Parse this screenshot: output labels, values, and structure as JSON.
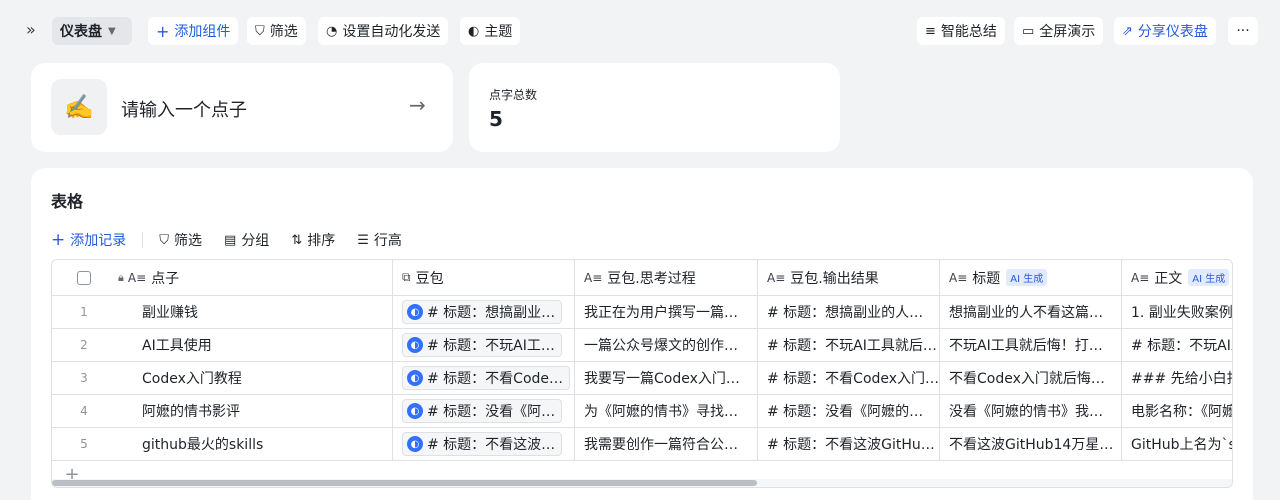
{
  "toolbar": {
    "dashboard_label": "仪表盘",
    "add_widget": "添加组件",
    "filter": "筛选",
    "automation": "设置自动化发送",
    "theme": "主题",
    "smart_summary": "智能总结",
    "fullscreen": "全屏演示",
    "share": "分享仪表盘",
    "more": "···"
  },
  "input_card": {
    "placeholder": "请输入一个点子",
    "icon": "✍️"
  },
  "count_card": {
    "label": "点字总数",
    "value": "5"
  },
  "table": {
    "title": "表格",
    "toolbar": {
      "add_record": "添加记录",
      "filter": "筛选",
      "group": "分组",
      "sort": "排序",
      "row_height": "行高"
    },
    "columns": [
      {
        "label": "点子",
        "ai": ""
      },
      {
        "label": "豆包",
        "ai": ""
      },
      {
        "label": "豆包.思考过程",
        "ai": ""
      },
      {
        "label": "豆包.输出结果",
        "ai": ""
      },
      {
        "label": "标题",
        "ai": "AI 生成"
      },
      {
        "label": "正文",
        "ai": "AI 生成"
      }
    ],
    "rows": [
      {
        "n": "1",
        "idea": "副业赚钱",
        "doubao": "# 标题：想搞副业…",
        "thinking": "我正在为用户撰写一篇…",
        "output": "# 标题：想搞副业的人…",
        "title": "想搞副业的人不看这篇…",
        "body": "1. 副业失败案例:"
      },
      {
        "n": "2",
        "idea": "AI工具使用",
        "doubao": "# 标题：不玩AI工…",
        "thinking": "一篇公众号爆文的创作…",
        "output": "# 标题：不玩AI工具就后…",
        "title": "不玩AI工具就后悔！打…",
        "body": "# 标题：不玩AI工"
      },
      {
        "n": "3",
        "idea": "Codex入门教程",
        "doubao": "# 标题：不看Code…",
        "thinking": "我要写一篇Codex入门…",
        "output": "# 标题：不看Codex入门…",
        "title": "不看Codex入门就后悔…",
        "body": "### 先给小白扫"
      },
      {
        "n": "4",
        "idea": "阿嬷的情书影评",
        "doubao": "# 标题：没看《阿…",
        "thinking": "为《阿嬷的情书》寻找…",
        "output": "# 标题：没看《阿嬷的…",
        "title": "没看《阿嬷的情书》我…",
        "body": "电影名称：《阿嬷"
      },
      {
        "n": "5",
        "idea": "github最火的skills",
        "doubao": "# 标题：不看这波…",
        "thinking": "我需要创作一篇符合公…",
        "output": "# 标题：不看这波GitHu…",
        "title": "不看这波GitHub14万星…",
        "body": "GitHub上名为`s"
      }
    ]
  }
}
